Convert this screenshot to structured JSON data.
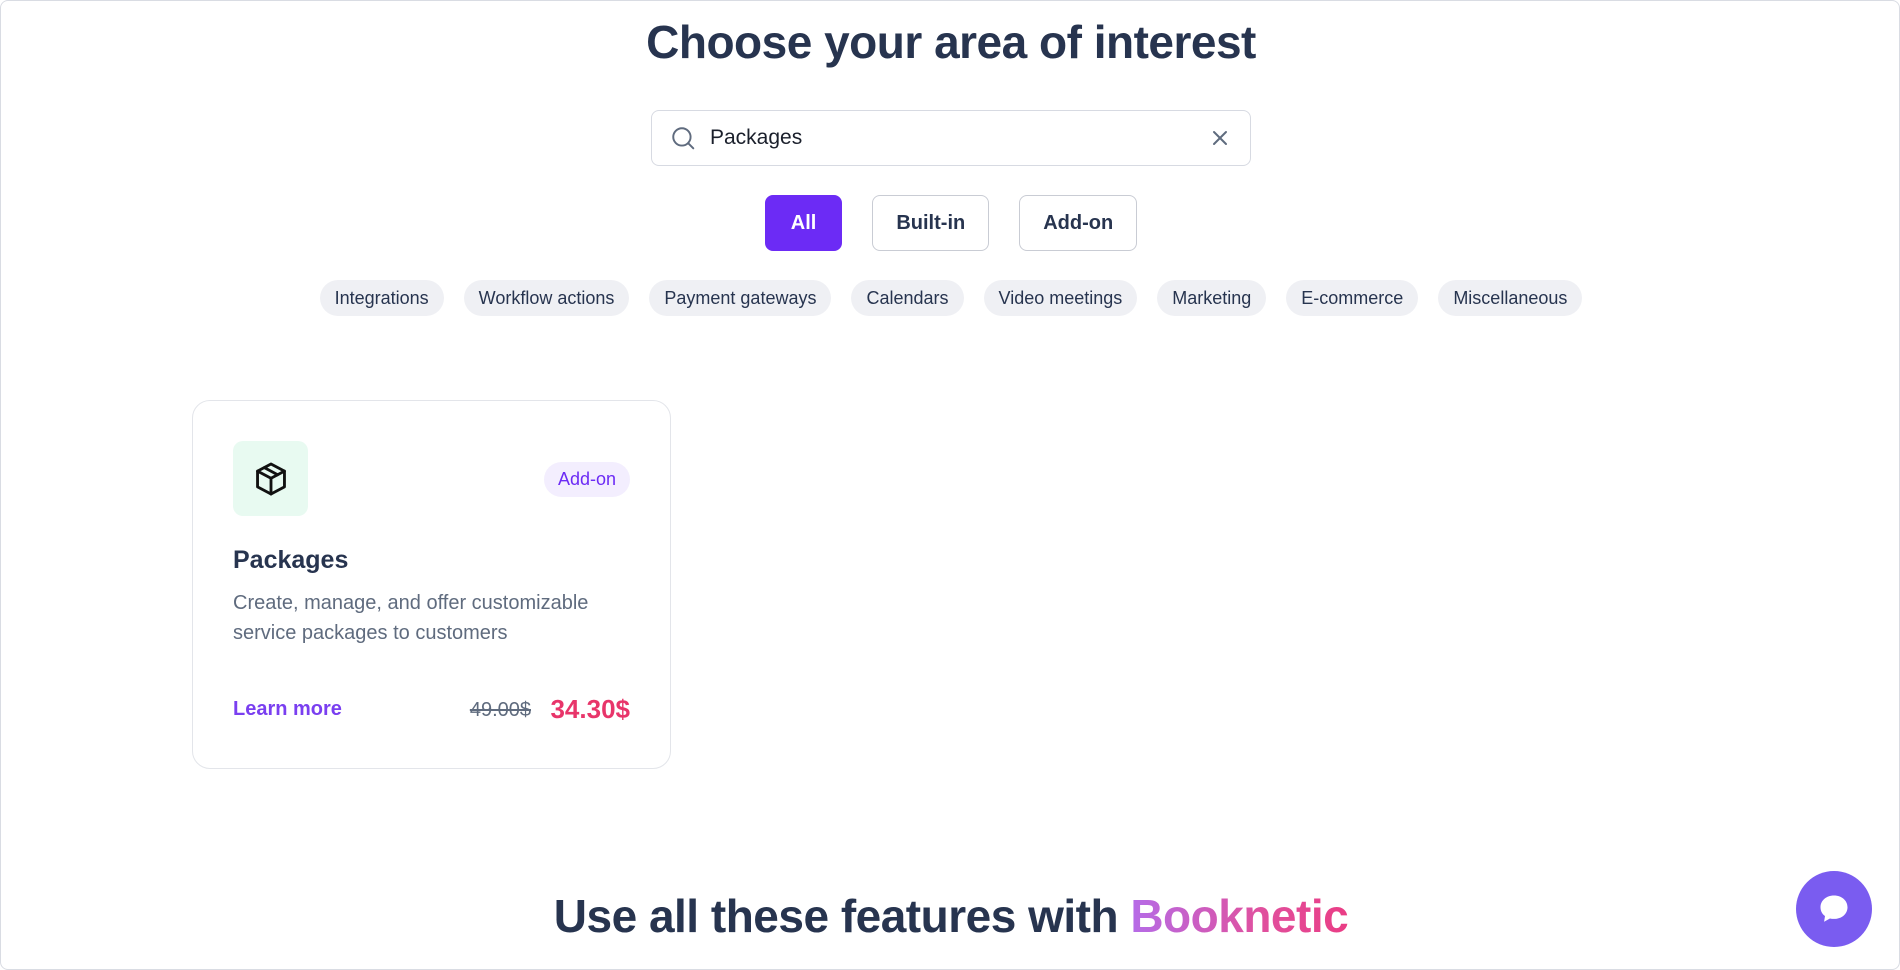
{
  "page": {
    "title": "Choose your area of interest"
  },
  "search": {
    "value": "Packages",
    "icon": "search-icon",
    "clear_icon": "close-icon"
  },
  "filters": [
    {
      "label": "All",
      "active": true
    },
    {
      "label": "Built-in",
      "active": false
    },
    {
      "label": "Add-on",
      "active": false
    }
  ],
  "categories": [
    "Integrations",
    "Workflow actions",
    "Payment gateways",
    "Calendars",
    "Video meetings",
    "Marketing",
    "E-commerce",
    "Miscellaneous"
  ],
  "card": {
    "icon": "package-icon",
    "badge": "Add-on",
    "title": "Packages",
    "description": "Create, manage, and offer customizable service packages to customers",
    "learn_more": "Learn more",
    "old_price": "49.00$",
    "new_price": "34.30$"
  },
  "footer": {
    "heading_prefix": "Use all these features with ",
    "heading_brand": "Booknetic"
  },
  "chat": {
    "icon": "chat-bubble-icon"
  },
  "colors": {
    "accent": "#6c2bf5",
    "heading": "#27344f",
    "price": "#e8356a",
    "chat": "#7a5cf0"
  }
}
